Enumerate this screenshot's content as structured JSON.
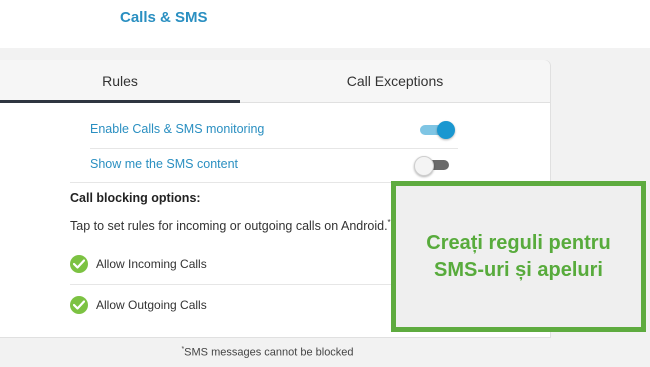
{
  "header": {
    "title": "Calls & SMS"
  },
  "tabs": [
    {
      "label": "Rules",
      "active": true
    },
    {
      "label": "Call Exceptions",
      "active": false
    }
  ],
  "settings": {
    "monitoring": {
      "label": "Enable Calls & SMS monitoring",
      "enabled": true
    },
    "sms_content": {
      "label": "Show me the SMS content",
      "enabled": false
    }
  },
  "call_blocking": {
    "title": "Call blocking options:",
    "description": "Tap to set rules for incoming or outgoing calls on Android.",
    "description_mark": "*",
    "options": [
      {
        "label": "Allow Incoming Calls",
        "checked": true
      },
      {
        "label": "Allow Outgoing Calls",
        "checked": true
      }
    ]
  },
  "footnote": {
    "mark": "*",
    "text": "SMS messages cannot be blocked"
  },
  "overlay": {
    "line1": "Creați reguli pentru",
    "line2": "SMS-uri și apeluri"
  },
  "colors": {
    "accent": "#2a8fc1",
    "check_green": "#7cc242",
    "overlay_green": "#5eab3f"
  },
  "icons": {
    "check": "checkmark-icon"
  }
}
